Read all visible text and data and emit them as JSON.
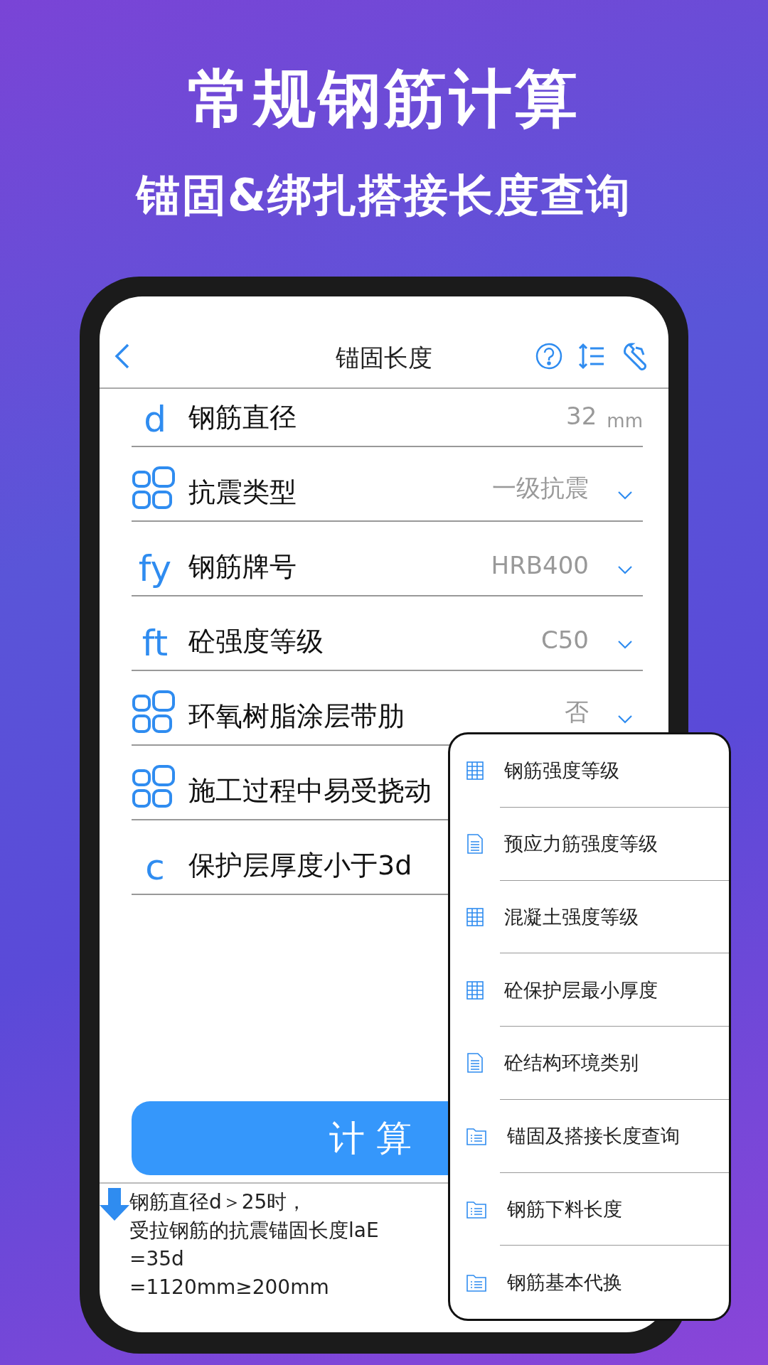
{
  "headline": "常规钢筋计算",
  "subheadline": "锚固&绑扎搭接长度查询",
  "nav": {
    "title": "锚固长度"
  },
  "fields": [
    {
      "icon": {
        "kind": "letter",
        "text": "d"
      },
      "label": "钢筋直径",
      "kind": "input",
      "value": "32",
      "unit": "mm"
    },
    {
      "icon": {
        "kind": "grid"
      },
      "label": "抗震类型",
      "kind": "select",
      "value": "一级抗震"
    },
    {
      "icon": {
        "kind": "letter",
        "text": "fy"
      },
      "label": "钢筋牌号",
      "kind": "select",
      "value": "HRB400"
    },
    {
      "icon": {
        "kind": "letter",
        "text": "ft"
      },
      "label": "砼强度等级",
      "kind": "select",
      "value": "C50"
    },
    {
      "icon": {
        "kind": "grid"
      },
      "label": "环氧树脂涂层带肋",
      "kind": "select",
      "value": "否"
    },
    {
      "icon": {
        "kind": "grid"
      },
      "label": "施工过程中易受挠动",
      "kind": "plain"
    },
    {
      "icon": {
        "kind": "letter",
        "text": "c"
      },
      "label": "保护层厚度小于3d",
      "kind": "plain"
    }
  ],
  "calculate_button": "计 算",
  "result_lines": [
    "钢筋直径d＞25时，",
    "受拉钢筋的抗震锚固长度laE",
    "=35d",
    "=1120mm≥200mm"
  ],
  "menu": [
    {
      "kind": "table",
      "label": "钢筋强度等级"
    },
    {
      "kind": "document",
      "label": "预应力筋强度等级"
    },
    {
      "kind": "table",
      "label": "混凝土强度等级"
    },
    {
      "kind": "table",
      "label": "砼保护层最小厚度"
    },
    {
      "kind": "document",
      "label": "砼结构环境类别"
    },
    {
      "kind": "folder",
      "label": "锚固及搭接长度查询"
    },
    {
      "kind": "folder",
      "label": "钢筋下料长度"
    },
    {
      "kind": "folder",
      "label": "钢筋基本代换"
    }
  ]
}
